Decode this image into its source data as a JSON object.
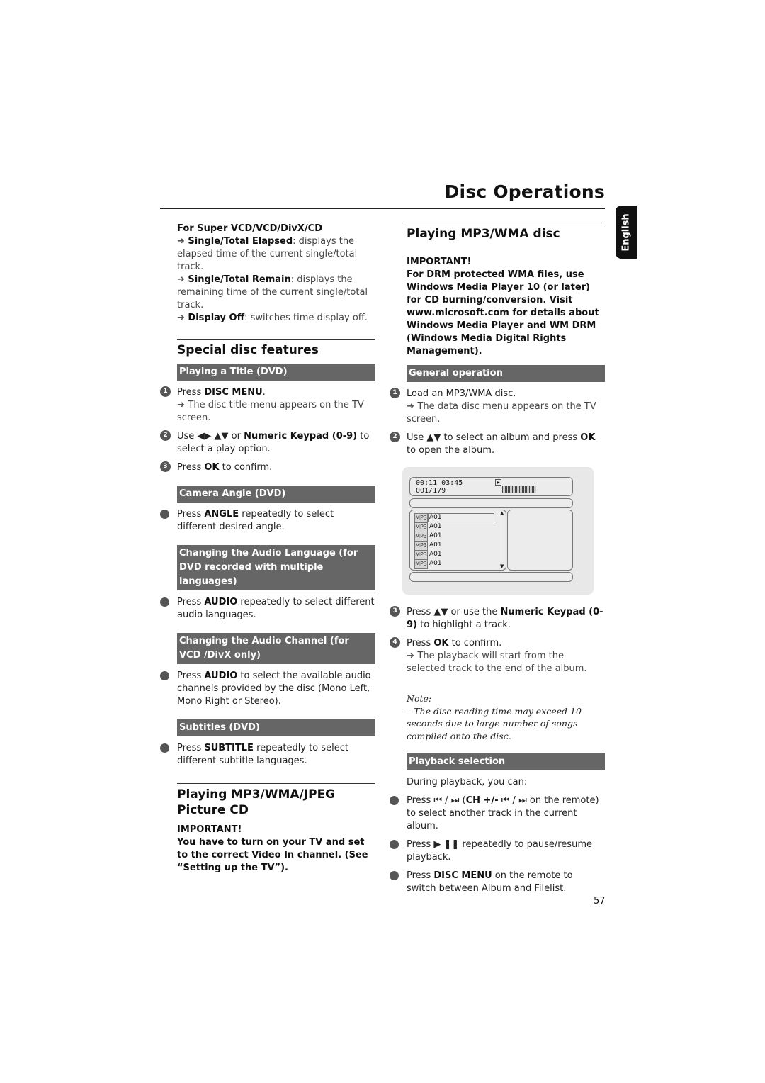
{
  "header": {
    "title": "Disc Operations",
    "language_tab": "English"
  },
  "left": {
    "super_vcd": {
      "heading": "For Super VCD/VCD/DivX/CD",
      "items": [
        {
          "bold": "Single/Total Elapsed",
          "rest": ": displays the elapsed time of the current single/total track."
        },
        {
          "bold": "Single/Total Remain",
          "rest": ": displays the remaining time of the current single/total track."
        },
        {
          "bold": "Display Off",
          "rest": ": switches time display off."
        }
      ]
    },
    "special": {
      "title": "Special disc features",
      "playing_title": {
        "bar": "Playing a Title (DVD)",
        "steps": [
          {
            "num": "1",
            "pre": "Press ",
            "bold": "DISC MENU",
            "post": ".",
            "sub": "The disc title menu appears on the TV screen."
          },
          {
            "num": "2",
            "pre": "Use ◀▶ ▲▼  or ",
            "bold": "Numeric Keypad (0-9)",
            "post": " to select a play option."
          },
          {
            "num": "3",
            "pre": "Press ",
            "bold": "OK",
            "post": " to confirm."
          }
        ]
      },
      "camera": {
        "bar": "Camera Angle (DVD)",
        "pre": "Press ",
        "bold": "ANGLE",
        "post": " repeatedly to select different desired angle."
      },
      "audio_lang": {
        "bar": "Changing the Audio Language (for DVD recorded with multiple languages)",
        "pre": "Press ",
        "bold": "AUDIO",
        "post": " repeatedly to select different audio languages."
      },
      "audio_channel": {
        "bar": "Changing the Audio Channel  (for VCD /DivX only)",
        "pre": "Press ",
        "bold": "AUDIO",
        "post": " to select the available audio channels provided by the disc (Mono Left, Mono Right or Stereo)."
      },
      "subtitles": {
        "bar": "Subtitles (DVD)",
        "pre": "Press ",
        "bold": "SUBTITLE",
        "post": " repeatedly to select different subtitle languages."
      }
    },
    "picture_cd": {
      "title": "Playing MP3/WMA/JPEG Picture CD",
      "important_label": "IMPORTANT!",
      "important_text": "You have to turn on your TV and set to the correct Video In channel. (See “Setting up the TV”)."
    }
  },
  "right": {
    "mp3": {
      "title": "Playing MP3/WMA disc",
      "important_label": "IMPORTANT!",
      "important_text": "For DRM protected WMA files, use Windows Media Player 10 (or later) for CD burning/conversion. Visit www.microsoft.com for details about Windows Media Player and WM DRM (Windows Media Digital Rights Management).",
      "general_bar": "General operation",
      "steps": [
        {
          "num": "1",
          "pre": "Load an MP3/WMA disc.",
          "bold": "",
          "post": "",
          "sub": "The data disc menu appears on the TV screen."
        },
        {
          "num": "2",
          "pre": "Use ▲▼  to select an album and press ",
          "bold": "OK",
          "post": " to open the album."
        }
      ],
      "screen": {
        "time": "00:11  03:45",
        "track": "001/179",
        "play_icon": "▶",
        "icon_text": "MP3",
        "items": [
          "A01",
          "A01",
          "A01",
          "A01",
          "A01",
          "A01"
        ]
      },
      "steps2": [
        {
          "num": "3",
          "pre": "Press ▲▼  or use the ",
          "bold": "Numeric Keypad (0-9)",
          "post": " to highlight a track."
        },
        {
          "num": "4",
          "pre": "Press ",
          "bold": "OK",
          "post": " to confirm.",
          "sub": "The playback will start from the selected track to the end of the album."
        }
      ],
      "note_label": "Note:",
      "note_text": "–  The disc reading time may exceed 10 seconds due to large number of songs compiled onto the disc.",
      "playback_bar": "Playback selection",
      "playback_intro": "During playback, you can:",
      "playback_items": [
        {
          "pre": "Press ⏮ / ⏭  (",
          "bold": "CH +/-",
          "post": " ⏮ / ⏭  on the remote) to select another track in the current album."
        },
        {
          "pre": "Press ▶ ❚❚ repeatedly to pause/resume playback.",
          "bold": "",
          "post": ""
        },
        {
          "pre": "Press ",
          "bold": "DISC MENU",
          "post": " on the remote to switch between Album and Filelist."
        }
      ]
    }
  },
  "footer": {
    "page_number": "57"
  }
}
